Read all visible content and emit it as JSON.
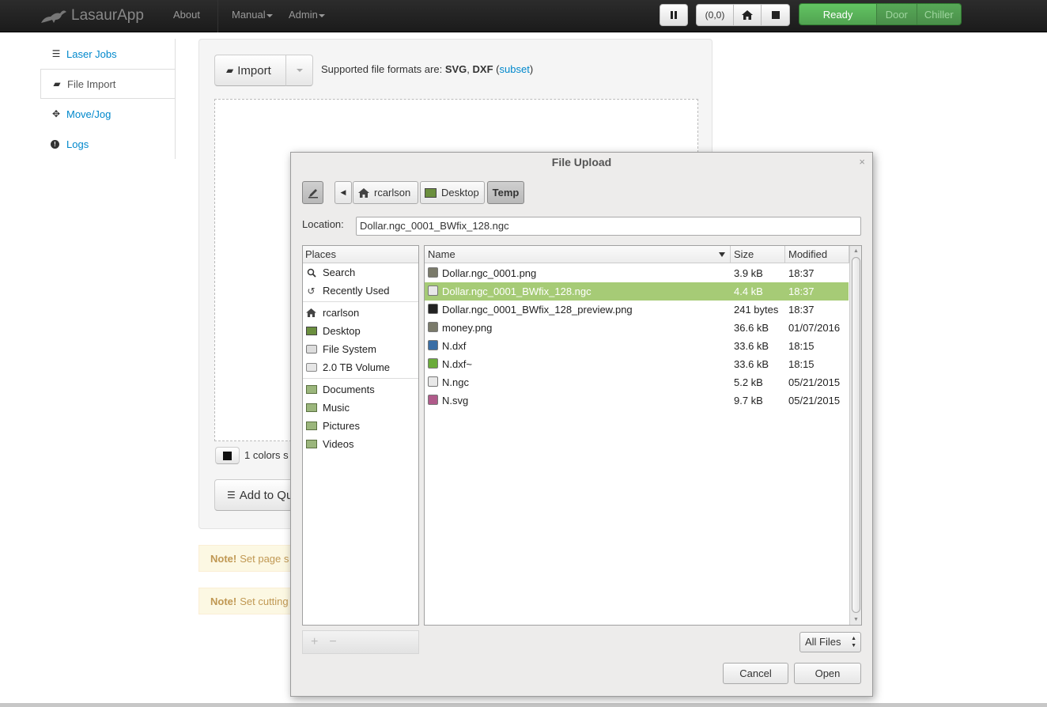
{
  "navbar": {
    "brand": "LasaurApp",
    "about": "About",
    "manual": "Manual",
    "admin": "Admin",
    "origin_label": "(0,0)",
    "status": {
      "ready": "Ready",
      "door": "Door",
      "chiller": "Chiller"
    }
  },
  "sidebar": {
    "items": [
      {
        "label": "Laser Jobs",
        "icon": "list-icon"
      },
      {
        "label": "File Import",
        "icon": "folder-open-icon"
      },
      {
        "label": "Move/Jog",
        "icon": "move-icon"
      },
      {
        "label": "Logs",
        "icon": "exclamation-circle-icon"
      }
    ]
  },
  "main": {
    "import_label": "Import",
    "formats_prefix": "Supported file formats are:",
    "format_svg": "SVG",
    "format_sep": ",",
    "format_dxf": "DXF",
    "format_open": "(",
    "subset_link": "subset",
    "format_close": ")",
    "colors_text": "1 colors s",
    "add_queue_label": "Add to Qu",
    "notes": [
      {
        "bold": "Note!",
        "text": "Set page s"
      },
      {
        "bold": "Note!",
        "text": "Set cutting"
      }
    ]
  },
  "dialog": {
    "title": "File Upload",
    "close": "×",
    "path_back": "◀",
    "path": [
      "rcarlson",
      "Desktop",
      "Temp"
    ],
    "location_label": "Location:",
    "location_value": "Dollar.ngc_0001_BWfix_128.ngc",
    "places_header": "Places",
    "places_group1": [
      {
        "label": "Search",
        "icon": "search-icon"
      },
      {
        "label": "Recently Used",
        "icon": "recent-icon"
      }
    ],
    "places_group2": [
      {
        "label": "rcarlson",
        "icon": "home-icon"
      },
      {
        "label": "Desktop",
        "icon": "desktop-icon"
      },
      {
        "label": "File System",
        "icon": "drive-icon"
      },
      {
        "label": "2.0 TB Volume",
        "icon": "volume-icon"
      }
    ],
    "places_group3": [
      {
        "label": "Documents",
        "icon": "folder-icon"
      },
      {
        "label": "Music",
        "icon": "folder-icon"
      },
      {
        "label": "Pictures",
        "icon": "folder-icon"
      },
      {
        "label": "Videos",
        "icon": "folder-icon"
      }
    ],
    "add_place": "+",
    "remove_place": "−",
    "columns": {
      "name": "Name",
      "size": "Size",
      "modified": "Modified"
    },
    "files": [
      {
        "name": "Dollar.ngc_0001.png",
        "size": "3.9 kB",
        "modified": "18:37",
        "icon": "image-icon",
        "color": "#7a7a6a"
      },
      {
        "name": "Dollar.ngc_0001_BWfix_128.ngc",
        "size": "4.4 kB",
        "modified": "18:37",
        "icon": "text-file-icon",
        "color": "#e8e8e8",
        "selected": true
      },
      {
        "name": "Dollar.ngc_0001_BWfix_128_preview.png",
        "size": "241 bytes",
        "modified": "18:37",
        "icon": "image-icon",
        "color": "#222222"
      },
      {
        "name": "money.png",
        "size": "36.6 kB",
        "modified": "01/07/2016",
        "icon": "image-icon",
        "color": "#7a7a6a"
      },
      {
        "name": "N.dxf",
        "size": "33.6 kB",
        "modified": "18:15",
        "icon": "drawing-icon",
        "color": "#3a6ea5"
      },
      {
        "name": "N.dxf~",
        "size": "33.6 kB",
        "modified": "18:15",
        "icon": "backup-icon",
        "color": "#6aab3a"
      },
      {
        "name": "N.ngc",
        "size": "5.2 kB",
        "modified": "05/21/2015",
        "icon": "text-file-icon",
        "color": "#e8e8e8"
      },
      {
        "name": "N.svg",
        "size": "9.7 kB",
        "modified": "05/21/2015",
        "icon": "svg-icon",
        "color": "#b05a8a"
      }
    ],
    "filter": "All Files",
    "cancel": "Cancel",
    "open": "Open"
  }
}
